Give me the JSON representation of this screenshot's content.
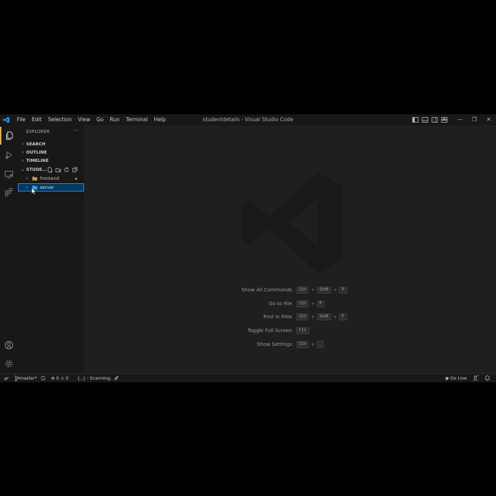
{
  "window": {
    "title": "studentdetails - Visual Studio Code"
  },
  "menu": [
    "File",
    "Edit",
    "Selection",
    "View",
    "Go",
    "Run",
    "Terminal",
    "Help"
  ],
  "window_controls": {
    "minimize": "—",
    "restore": "❐",
    "close": "✕"
  },
  "sidebar": {
    "header": "EXPLORER",
    "more": "···",
    "sections": {
      "search": "SEARCH",
      "outline": "OUTLINE",
      "timeline": "TIMELINE",
      "folder": "STUDE..."
    },
    "tree": [
      {
        "label": "frontend",
        "modified": true
      },
      {
        "label": "server",
        "selected": true
      }
    ]
  },
  "shortcuts": [
    {
      "label": "Show All Commands",
      "keys": [
        "Ctrl",
        "Shift",
        "P"
      ]
    },
    {
      "label": "Go to File",
      "keys": [
        "Ctrl",
        "P"
      ]
    },
    {
      "label": "Find in Files",
      "keys": [
        "Ctrl",
        "Shift",
        "F"
      ]
    },
    {
      "label": "Toggle Full Screen",
      "keys": [
        "F11"
      ]
    },
    {
      "label": "Show Settings",
      "keys": [
        "Ctrl",
        ","
      ]
    }
  ],
  "status": {
    "branch": "master*",
    "errors": "0",
    "warnings": "0",
    "task": "{..} : Scanning..",
    "go_live": "Go Live"
  },
  "colors": {
    "accent": "#e0b04e",
    "selection": "#3a7ee0",
    "folder": "#e2c08d",
    "vscode_blue": "#23a9f2"
  }
}
